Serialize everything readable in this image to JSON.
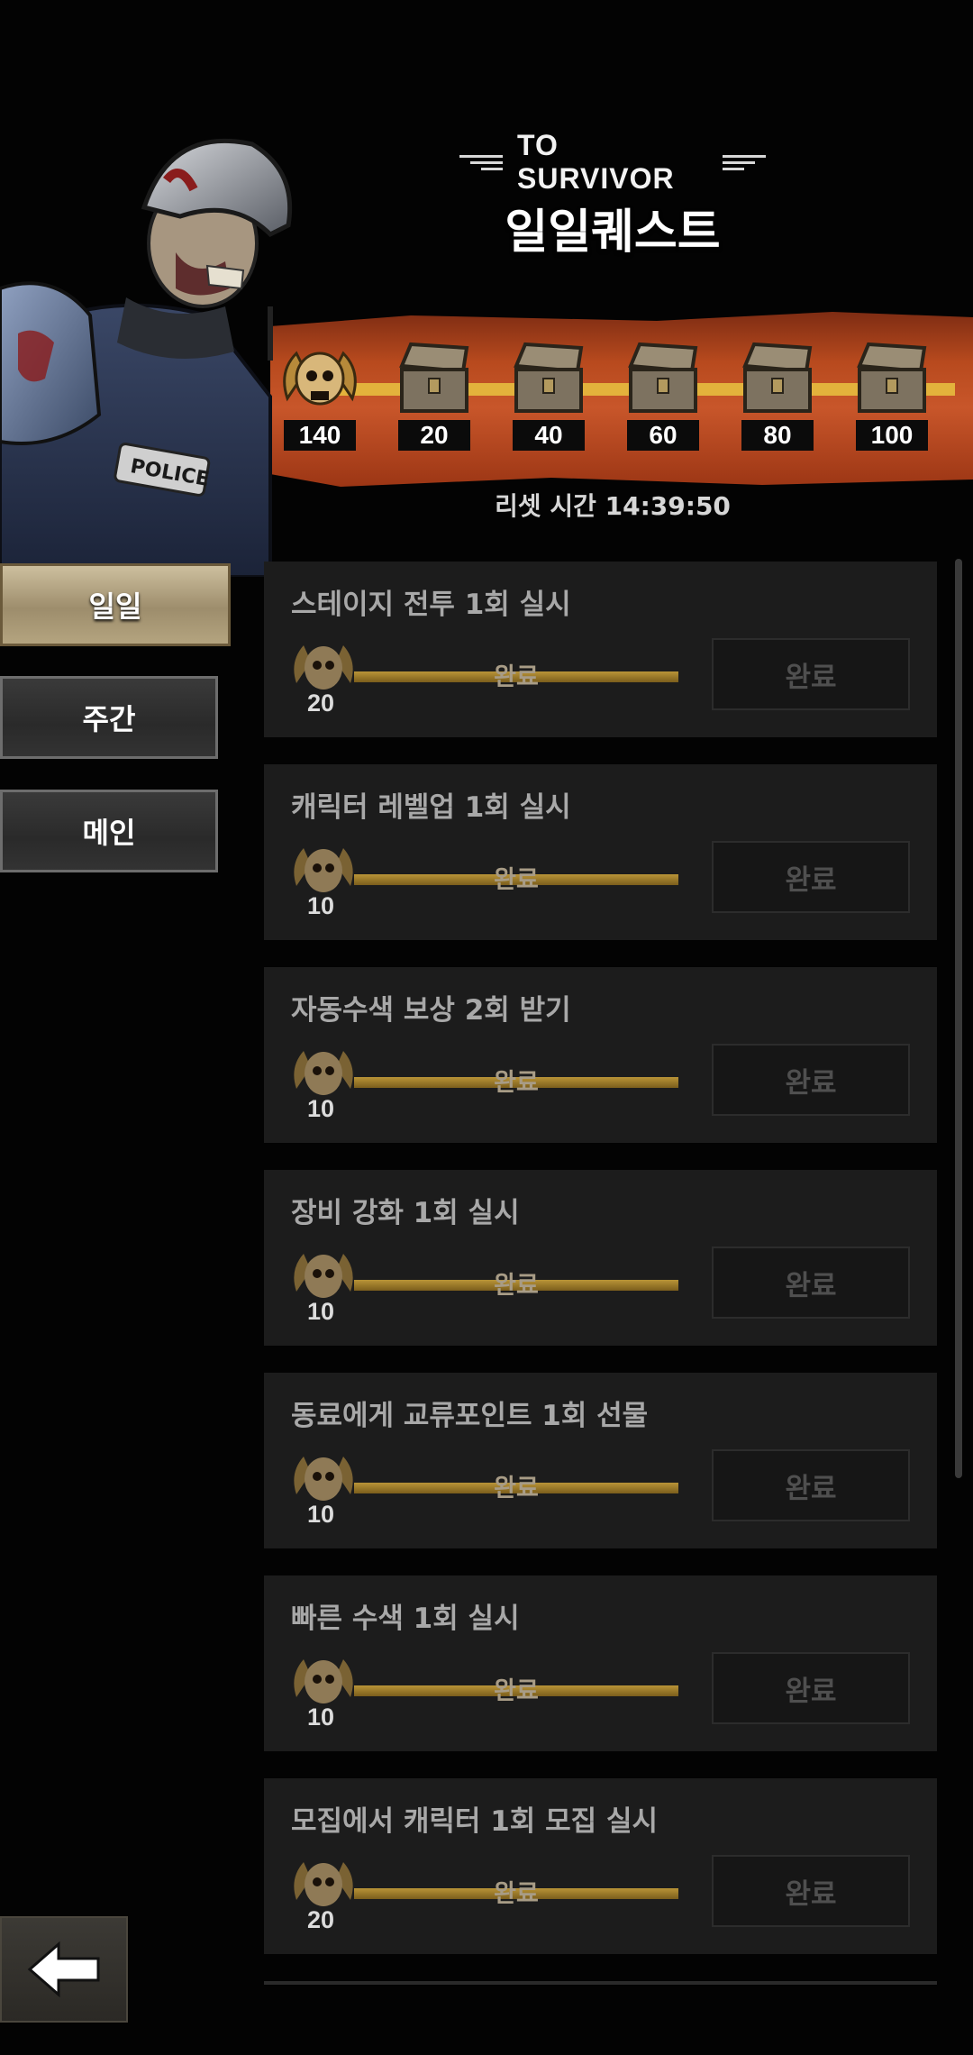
{
  "header": {
    "subtitle": "TO SURVIVOR",
    "title": "일일퀘스트"
  },
  "milestones": [
    {
      "label": "140",
      "icon": "skull-emblem-icon"
    },
    {
      "label": "20",
      "icon": "chest-icon"
    },
    {
      "label": "40",
      "icon": "chest-icon"
    },
    {
      "label": "60",
      "icon": "chest-icon"
    },
    {
      "label": "80",
      "icon": "chest-icon"
    },
    {
      "label": "100",
      "icon": "chest-icon"
    }
  ],
  "reset_time": "리셋 시간 14:39:50",
  "tabs": [
    {
      "label": "일일",
      "active": true
    },
    {
      "label": "주간",
      "active": false
    },
    {
      "label": "메인",
      "active": false
    }
  ],
  "quests": [
    {
      "title": "스테이지 전투 1회 실시",
      "reward": "20",
      "progress_label": "완료",
      "button": "완료"
    },
    {
      "title": "캐릭터 레벨업 1회 실시",
      "reward": "10",
      "progress_label": "완료",
      "button": "완료"
    },
    {
      "title": "자동수색 보상 2회 받기",
      "reward": "10",
      "progress_label": "완료",
      "button": "완료"
    },
    {
      "title": "장비 강화 1회 실시",
      "reward": "10",
      "progress_label": "완료",
      "button": "완료"
    },
    {
      "title": "동료에게 교류포인트 1회 선물",
      "reward": "10",
      "progress_label": "완료",
      "button": "완료"
    },
    {
      "title": "빠른 수색 1회 실시",
      "reward": "10",
      "progress_label": "완료",
      "button": "완료"
    },
    {
      "title": "모집에서 캐릭터 1회 모집 실시",
      "reward": "20",
      "progress_label": "완료",
      "button": "완료"
    }
  ],
  "colors": {
    "banner": "#b84a1e",
    "progress_gold": "#e3b23c",
    "card_bg": "#1c1c1c",
    "tab_active": "#b4a47f"
  }
}
